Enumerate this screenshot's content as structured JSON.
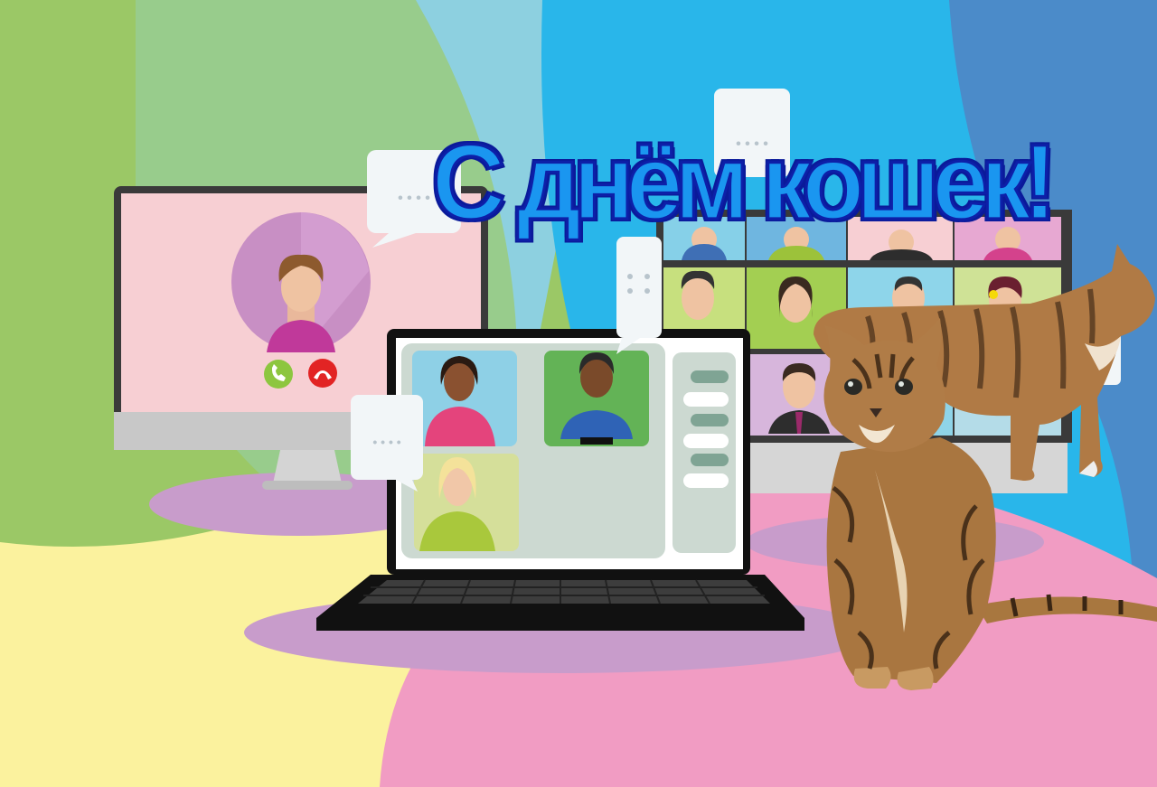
{
  "greeting": {
    "title": "С днём кошек!"
  },
  "palette": {
    "bg_green": "#9bc866",
    "bg_light_green": "#98cc8c",
    "bg_light_blue": "#8dd0e0",
    "bg_blue": "#29b6ea",
    "bg_dark_blue": "#4b8bc9",
    "bg_yellow": "#fbf29e",
    "bg_pink": "#f19cc3",
    "title_fill": "#1a96f0",
    "title_outline": "#0a1a9a"
  },
  "scene": {
    "devices": [
      "desktop-monitor",
      "laptop",
      "video-wall-monitor"
    ],
    "call_buttons": [
      "accept-call-icon",
      "decline-call-icon"
    ],
    "chat_bubble_text": "• • • •",
    "animals": [
      "tabby-cat-sitting",
      "tabby-cat-walking"
    ]
  }
}
